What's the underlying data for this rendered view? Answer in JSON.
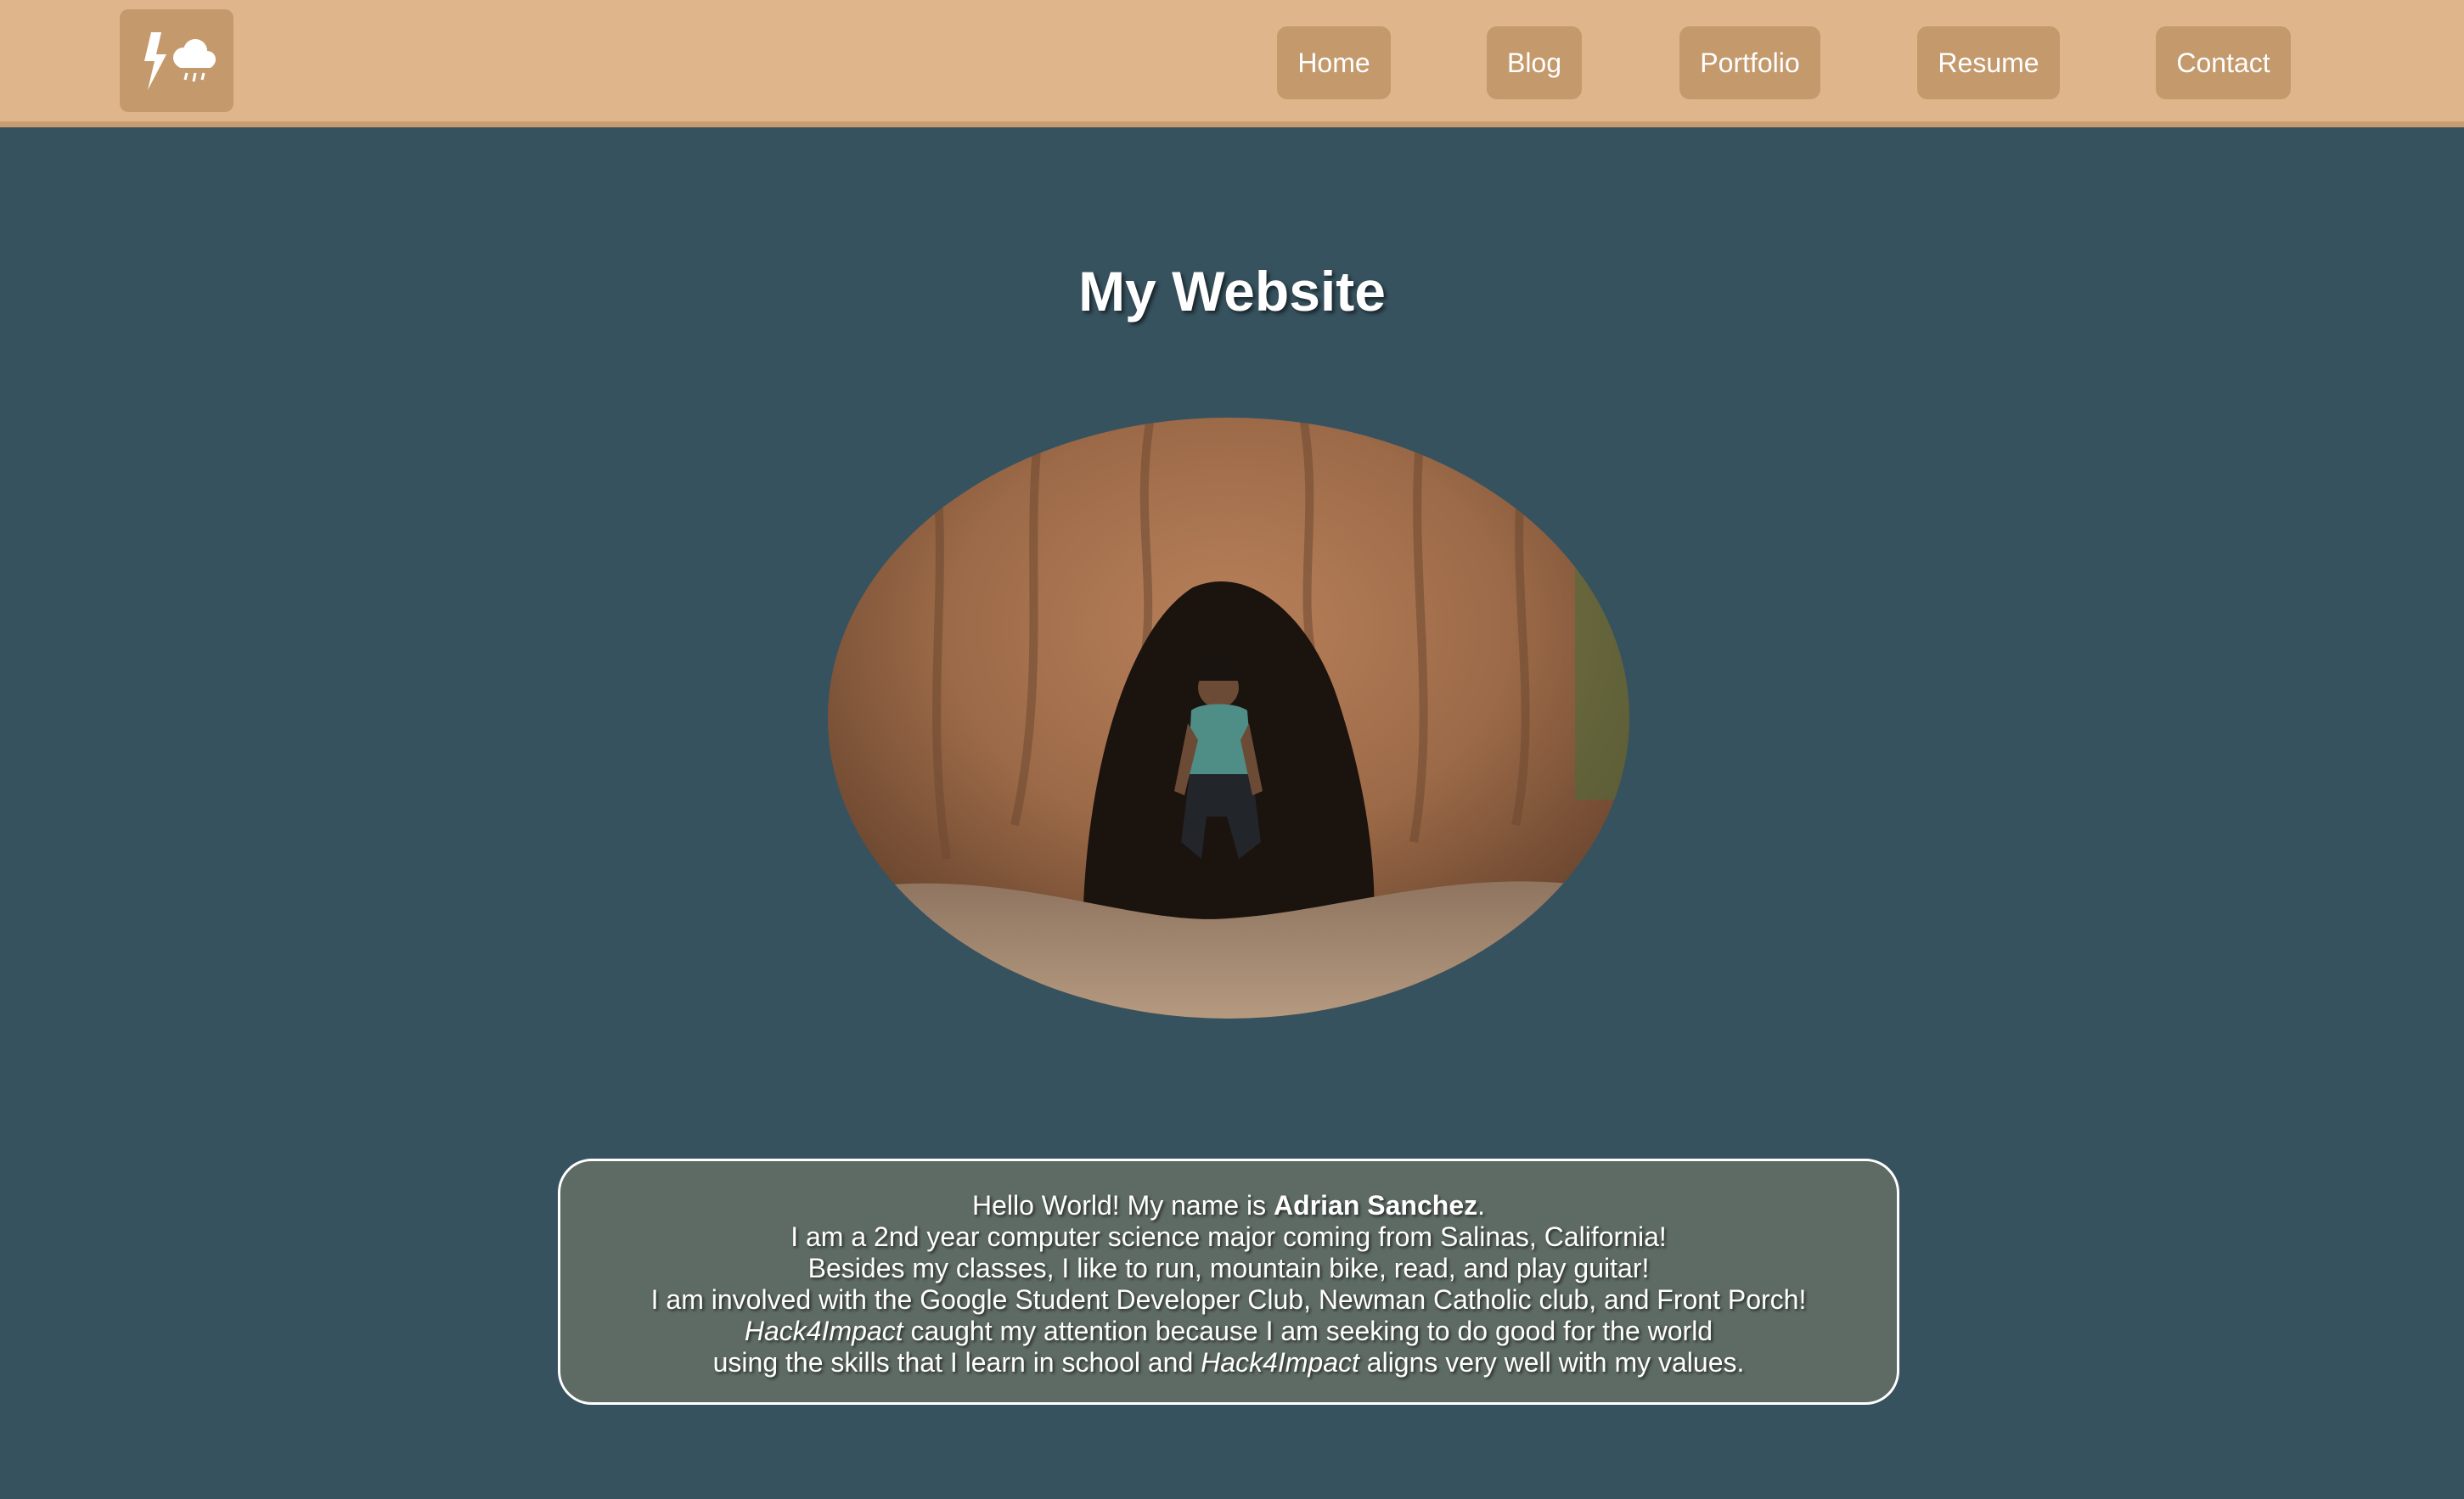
{
  "navbar": {
    "logo_icon": "lightning-cloud-icon",
    "bar_color": "#dfb68b",
    "button_color": "#c49a6d",
    "links": [
      {
        "label": "Home"
      },
      {
        "label": "Blog"
      },
      {
        "label": "Portfolio"
      },
      {
        "label": "Resume"
      },
      {
        "label": "Contact"
      }
    ]
  },
  "main": {
    "title": "My Website",
    "background_color": "#36525e",
    "photo_subject": "person-crouching-in-redwood-tree-hollow",
    "bio": {
      "l1_pre": "Hello World! My name is ",
      "l1_name": "Adrian Sanchez",
      "l1_post": ".",
      "l2": "I am a 2nd year computer science major coming from Salinas, California!",
      "l3": "Besides my classes, I like to run, mountain bike, read, and play guitar!",
      "l4": "I am involved with the Google Student Developer Club, Newman Catholic club, and Front Porch!",
      "l5_em": "Hack4Impact",
      "l5_post": " caught my attention because I am seeking to do good for the world",
      "l6_pre": "using the skills that I learn in school and ",
      "l6_em": "Hack4Impact",
      "l6_post": " aligns very well with my values."
    }
  }
}
